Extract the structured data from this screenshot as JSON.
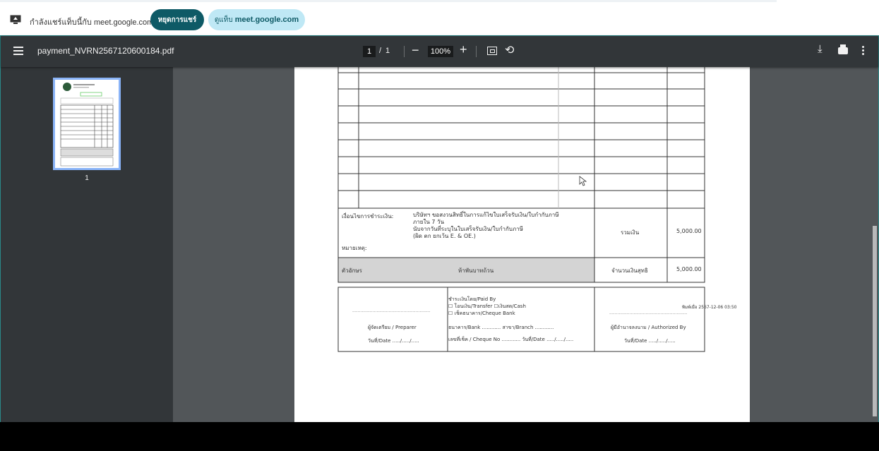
{
  "share_bar": {
    "share_text": "กำลังแชร์แท็บนี้กับ meet.google.com",
    "stop_button": "หยุดการแชร์",
    "view_prefix": "ดูแท็บ",
    "view_domain": "meet.google.com"
  },
  "toolbar": {
    "filename": "payment_NVRN2567120600184.pdf",
    "page_current": "1",
    "page_separator": "/",
    "page_total": "1",
    "zoom": "100%"
  },
  "sidebar": {
    "thumbnail_label": "1"
  },
  "document": {
    "conditions_label": "เงื่อนไขการชำระเงิน:",
    "conditions_line1": "บริษัทฯ ขอสงวนสิทธิ์ในการแก้ไขใบเสร็จรับเงิน/ใบกำกับภาษี",
    "conditions_line2": "ภายใน 7 วัน",
    "conditions_line3": "นับจากวันที่ระบุในใบเสร็จรับเงิน/ใบกำกับภาษี",
    "conditions_line4": "(ผิด ตก ยกเว้น E. & OE.)",
    "remark_label": "หมายเหตุ:",
    "subtotal_label": "รวมเงิน",
    "subtotal_value": "5,000.00",
    "letters_label": "ตัวอักษร",
    "amount_in_words": "ห้าพันบาทถ้วน",
    "net_label": "จำนวนเงินสุทธิ",
    "net_value": "5,000.00",
    "preparer_dots": "..........................................................",
    "preparer_label": "ผู้จัดเตรียม / Preparer",
    "preparer_date": "วันที่/Date ...../...../.....",
    "paid_by_label": "ชำระเงินโดย/Paid By",
    "paid_transfer": "☐ โอนเงิน/Transfer ☐เงินสด/Cash",
    "paid_cheque": "☐ เช็คธนาคาร/Cheque Bank",
    "bank_label": "ธนาคาร/Bank ............ สาขา/Branch ............",
    "cheque_label": "เลขที่เช็ค / Cheque No ............ วันที่/Date ...../...../.....",
    "printed_at": "พิมพ์เมื่อ 2567-12-06 03:50",
    "authorized_dots": "..........................................................",
    "authorized_label": "ผู้มีอำนาจลงนาม / Authorized By",
    "authorized_date": "วันที่/Date ...../...../....."
  },
  "colors": {
    "stop_button_bg": "#0e5a66",
    "view_button_bg": "#bfe8f5",
    "toolbar_bg": "#323639",
    "viewer_bg": "#525659",
    "thumbnail_border": "#8ab4f8"
  }
}
